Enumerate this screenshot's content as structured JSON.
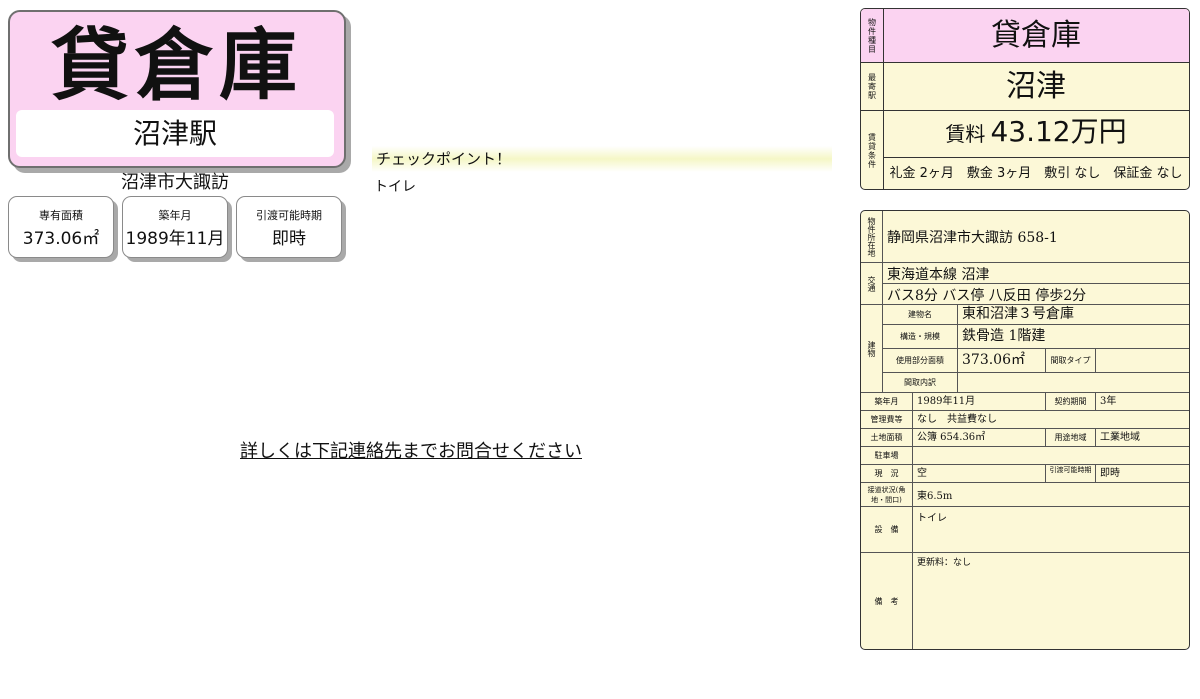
{
  "header": {
    "property_type": "貸倉庫",
    "station": "沼津駅",
    "area": "沼津市大諏訪"
  },
  "info_boxes": [
    {
      "label": "専有面積",
      "value": "373.06㎡"
    },
    {
      "label": "築年月",
      "value": "1989年11月"
    },
    {
      "label": "引渡可能時期",
      "value": "即時"
    }
  ],
  "checkpoint": {
    "heading": "チェックポイント！",
    "text": "トイレ"
  },
  "contact_link": "詳しくは下記連絡先までお問合せください",
  "summary": {
    "type_label": "物件種目",
    "type_value": "貸倉庫",
    "station_label": "最寄駅",
    "station_value": "沼津",
    "conditions_label": "賃貸条件",
    "rent_prefix": "賃料",
    "rent_value": "43.12万円",
    "fees": "礼金 2ヶ月　敷金 3ヶ月　敷引 なし　保証金 なし"
  },
  "details": {
    "location_label": "物件所在地",
    "location_value": "静岡県沼津市大諏訪 658-1",
    "transport_label": "交通",
    "transport_line1": "東海道本線 沼津",
    "transport_line2": "バス8分 バス停 八反田 停歩2分",
    "building_label": "建物",
    "building_name_label": "建物名",
    "building_name_value": "東和沼津３号倉庫",
    "structure_label": "構造・規模",
    "structure_value": "鉄骨造 1階建",
    "floor_area_label": "使用部分面積",
    "floor_area_value": "373.06㎡",
    "layout_type_label": "間取タイプ",
    "layout_type_value": "",
    "layout_detail_label": "間取内訳",
    "layout_detail_value": "",
    "built_label": "築年月",
    "built_value": "1989年11月",
    "contract_label": "契約期間",
    "contract_value": "3年",
    "mgmt_label": "管理費等",
    "mgmt_value": "なし　共益費なし",
    "land_label": "土地面積",
    "land_value": "公簿 654.36㎡",
    "zoning_label": "用途地域",
    "zoning_value": "工業地域",
    "parking_label": "駐車場",
    "parking_value": "",
    "status_label": "現　況",
    "status_value": "空",
    "handover_label": "引渡可能時期",
    "handover_value": "即時",
    "road_label": "接道状況(角地・間口)",
    "road_value": "東6.5m",
    "equipment_label": "設　備",
    "equipment_value": "トイレ",
    "remarks_label": "備　考",
    "remarks_value": "更新料：なし"
  }
}
